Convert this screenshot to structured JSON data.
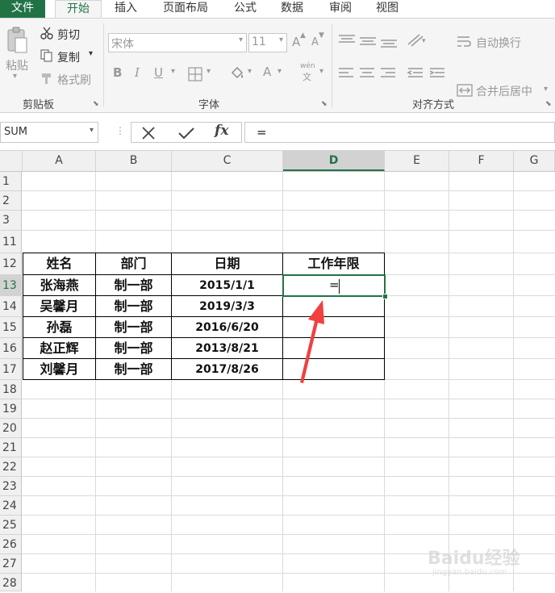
{
  "menu": {
    "tabs": [
      "文件",
      "开始",
      "插入",
      "页面布局",
      "公式",
      "数据",
      "审阅",
      "视图"
    ]
  },
  "ribbon": {
    "clipboard": {
      "paste": "粘贴",
      "cut": "剪切",
      "copy": "复制",
      "format_painter": "格式刷",
      "group_label": "剪贴板"
    },
    "font": {
      "font_name": "宋体",
      "font_size": "11",
      "bold": "B",
      "italic": "I",
      "underline": "U",
      "grow": "A",
      "shrink": "A",
      "font_color": "A",
      "phonetic_top": "wén",
      "phonetic_bottom": "文",
      "group_label": "字体"
    },
    "alignment": {
      "wrap_text": "自动换行",
      "merge_center": "合并后居中",
      "group_label": "对齐方式"
    }
  },
  "formula_bar": {
    "name_box": "SUM",
    "fx": "fx",
    "content": "="
  },
  "columns": [
    "A",
    "B",
    "C",
    "D",
    "E",
    "F",
    "G"
  ],
  "rows": [
    "1",
    "2",
    "3",
    "11",
    "12",
    "13",
    "14",
    "15",
    "16",
    "17",
    "18",
    "19",
    "20",
    "21",
    "22",
    "23",
    "24",
    "25",
    "26",
    "27",
    "28"
  ],
  "table": {
    "headers": [
      "姓名",
      "部门",
      "日期",
      "工作年限"
    ],
    "rows": [
      [
        "张海燕",
        "制一部",
        "2015/1/1",
        "="
      ],
      [
        "吴馨月",
        "制一部",
        "2019/3/3",
        ""
      ],
      [
        "孙磊",
        "制一部",
        "2016/6/20",
        ""
      ],
      [
        "赵正辉",
        "制一部",
        "2013/8/21",
        ""
      ],
      [
        "刘馨月",
        "制一部",
        "2017/8/26",
        ""
      ]
    ]
  },
  "selection": {
    "active_column": "D",
    "active_row": "13"
  },
  "colors": {
    "accent": "#217346",
    "arrow": "#f04040"
  },
  "watermark": {
    "brand": "Baidu经验",
    "url": "jingyan.baidu.com"
  }
}
